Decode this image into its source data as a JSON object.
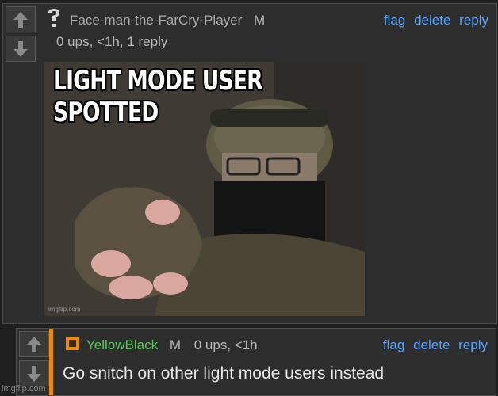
{
  "comment1": {
    "author": "Face-man-the-FarCry-Player",
    "badge": "M",
    "stats": "0 ups, <1h, 1 reply",
    "actions": {
      "flag": "flag",
      "delete": "delete",
      "reply": "reply"
    },
    "meme": {
      "caption": "LIGHT MODE USER SPOTTED",
      "watermark": "imgflip.com"
    }
  },
  "comment2": {
    "author": "YellowBlack",
    "badge": "M",
    "stats": "0 ups, <1h",
    "text": "Go snitch on other light mode users instead",
    "actions": {
      "flag": "flag",
      "delete": "delete",
      "reply": "reply"
    }
  },
  "page_watermark": "imgflip.com",
  "colors": {
    "link": "#57a4ff",
    "accent": "#f08c00",
    "username_green": "#5cc95c"
  }
}
